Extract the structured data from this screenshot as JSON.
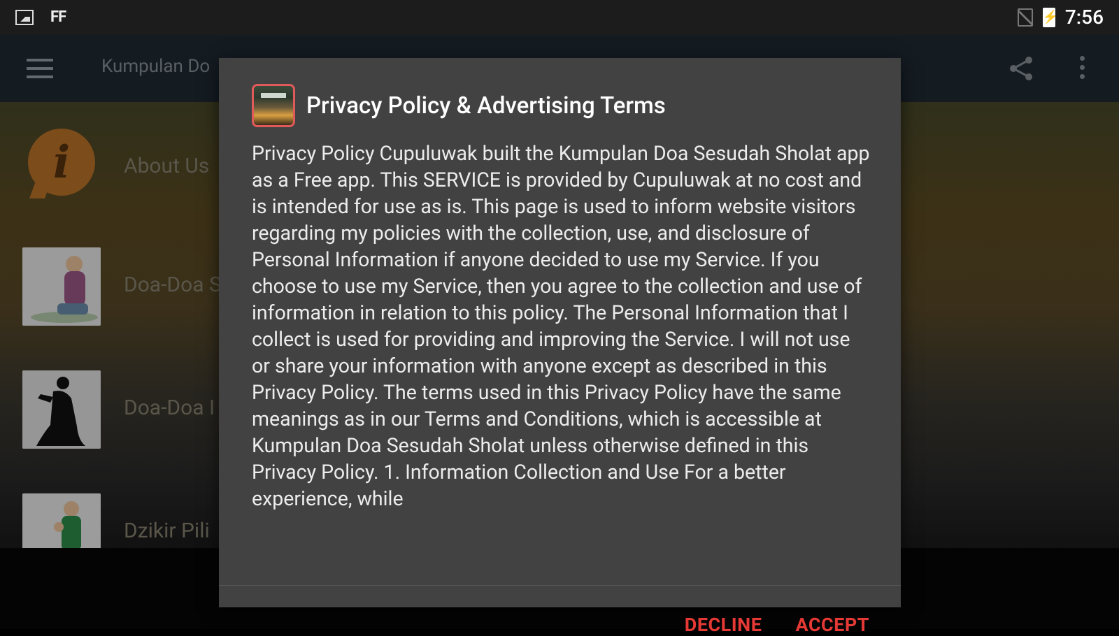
{
  "status_bar": {
    "left_icons": [
      "image-notification-icon",
      "ff-notification-icon"
    ],
    "ff_text": "FF",
    "battery_glyph": "⚡",
    "time": "7:56"
  },
  "app_bar": {
    "title": "Kumpulan Do"
  },
  "list": {
    "items": [
      {
        "label": "About Us",
        "icon": "info-icon"
      },
      {
        "label": "Doa-Doa S",
        "icon": "praying-child-thumbnail"
      },
      {
        "label": "Doa-Doa I",
        "icon": "praying-silhouette-thumbnail"
      },
      {
        "label": "Dzikir Pili",
        "icon": "dzikir-child-thumbnail"
      }
    ]
  },
  "dialog": {
    "title": "Privacy Policy & Advertising Terms",
    "body": "Privacy Policy Cupuluwak built the Kumpulan Doa Sesudah Sholat app as a Free app. This SERVICE is provided by Cupuluwak at no cost and is intended for use as is. This page is used to inform website visitors regarding my policies with the collection, use, and disclosure of Personal Information if anyone decided to use my Service. If you choose to use my Service, then you agree to the collection and use of information in relation to this policy. The Personal Information that I collect is used for providing and improving the Service. I will not use or share your information with anyone except as described in this Privacy Policy. The terms used in this Privacy Policy have the same meanings as in our Terms and Conditions, which is accessible at Kumpulan Doa Sesudah Sholat unless otherwise defined in this Privacy Policy. 1. Information Collection and Use For a better experience, while",
    "decline_label": "DECLINE",
    "accept_label": "ACCEPT",
    "accent_color": "#e53935"
  }
}
